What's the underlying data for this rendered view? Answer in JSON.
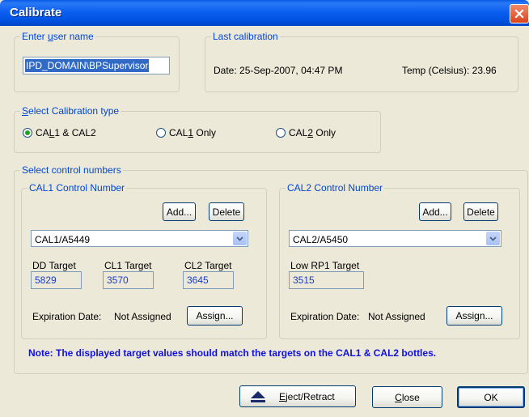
{
  "window": {
    "title": "Calibrate"
  },
  "user": {
    "legend_pre": "Enter ",
    "legend_u": "u",
    "legend_post": "ser name",
    "value": "IPD_DOMAIN\\BPSupervisor"
  },
  "last_calibration": {
    "legend": "Last calibration",
    "date_text": "Date: 25-Sep-2007, 04:47 PM",
    "temp_text": "Temp (Celsius): 23.96"
  },
  "cal_type": {
    "legend_u": "S",
    "legend_post": "elect Calibration type",
    "options": [
      {
        "pre": "CA",
        "u": "L",
        "post": "1 & CAL2"
      },
      {
        "pre": "CAL",
        "u": "1",
        "post": " Only"
      },
      {
        "pre": "CAL",
        "u": "2",
        "post": " Only"
      }
    ]
  },
  "control": {
    "legend": "Select control numbers"
  },
  "cal1": {
    "legend": "CAL1 Control Number",
    "add_label": "Add...",
    "delete_label": "Delete",
    "selected": "CAL1/A5449",
    "targets": [
      {
        "label": "DD Target",
        "value": "5829"
      },
      {
        "label": "CL1 Target",
        "value": "3570"
      },
      {
        "label": "CL2 Target",
        "value": "3645"
      }
    ],
    "expiration_label": "Expiration Date:",
    "expiration_value": "Not Assigned",
    "assign_label": "Assign..."
  },
  "cal2": {
    "legend": "CAL2 Control Number",
    "add_label": "Add...",
    "delete_label": "Delete",
    "selected": "CAL2/A5450",
    "targets": [
      {
        "label": "Low RP1 Target",
        "value": "3515"
      }
    ],
    "expiration_label": "Expiration Date:",
    "expiration_value": "Not Assigned",
    "assign_label": "Assign..."
  },
  "note": "Note: The displayed target values should match the targets on the CAL1 & CAL2 bottles.",
  "footer": {
    "eject_u": "E",
    "eject_post": "ject/Retract",
    "close_u": "C",
    "close_post": "lose",
    "ok_label": "OK"
  }
}
